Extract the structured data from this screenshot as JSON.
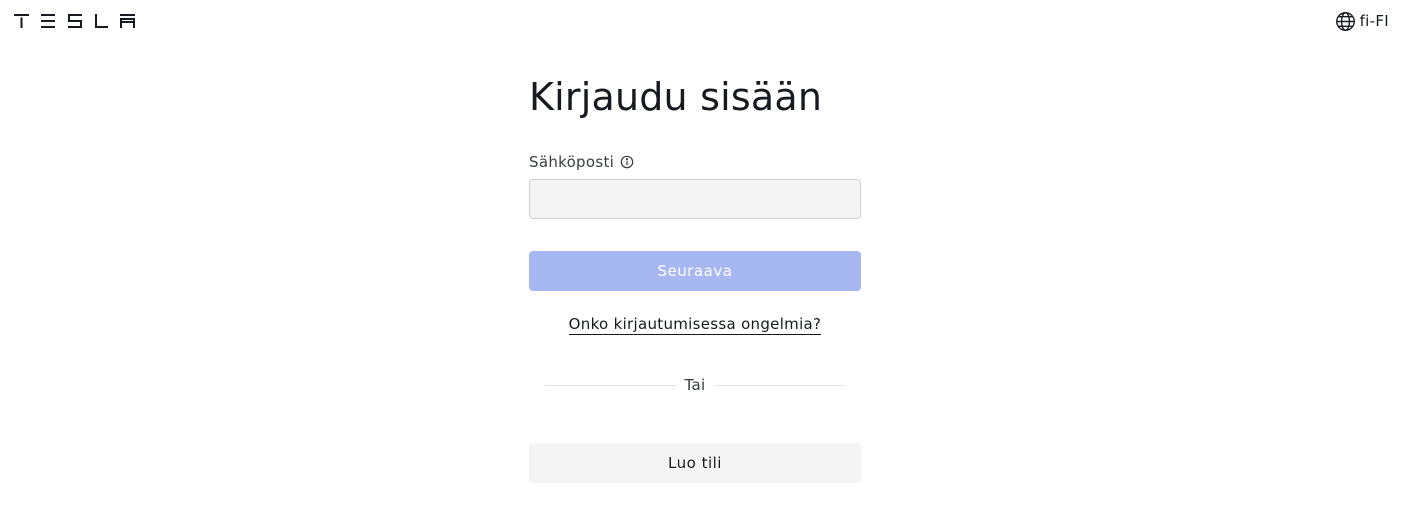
{
  "header": {
    "logo_icon": "tesla-wordmark-icon",
    "locale_icon": "globe-icon",
    "locale_label": "fi-FI"
  },
  "login": {
    "title": "Kirjaudu sisään",
    "email_label": "Sähköposti",
    "email_info_icon": "info-icon",
    "email_value": "",
    "next_label": "Seuraava",
    "trouble_link": "Onko kirjautumisessa ongelmia?",
    "divider_text": "Tai",
    "create_account_label": "Luo tili"
  },
  "colors": {
    "primary_disabled": "#a6b7f2",
    "input_bg": "#f4f4f4",
    "text": "#171a20"
  }
}
